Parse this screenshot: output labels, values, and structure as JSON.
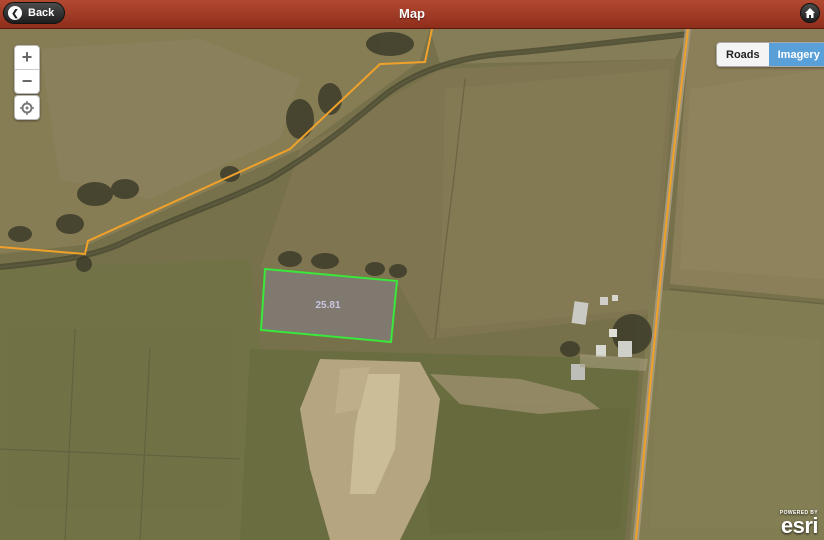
{
  "header": {
    "title": "Map",
    "back_label": "Back"
  },
  "map": {
    "parcel_label": "25.81",
    "basemap_toggle": {
      "options": [
        "Roads",
        "Imagery"
      ],
      "selected": "Imagery"
    },
    "attribution": {
      "powered_by": "POWERED BY",
      "logo": "esri"
    }
  },
  "icons": {
    "back": "chevron-left-icon",
    "home": "home-icon",
    "zoom_in": "plus-icon",
    "zoom_out": "minus-icon",
    "locate": "locate-icon"
  },
  "colors": {
    "header": "#9e3a24",
    "parcel_outline": "#39e83a",
    "boundary_line": "#f0a12a",
    "selected_toggle": "#5aa0d8"
  }
}
